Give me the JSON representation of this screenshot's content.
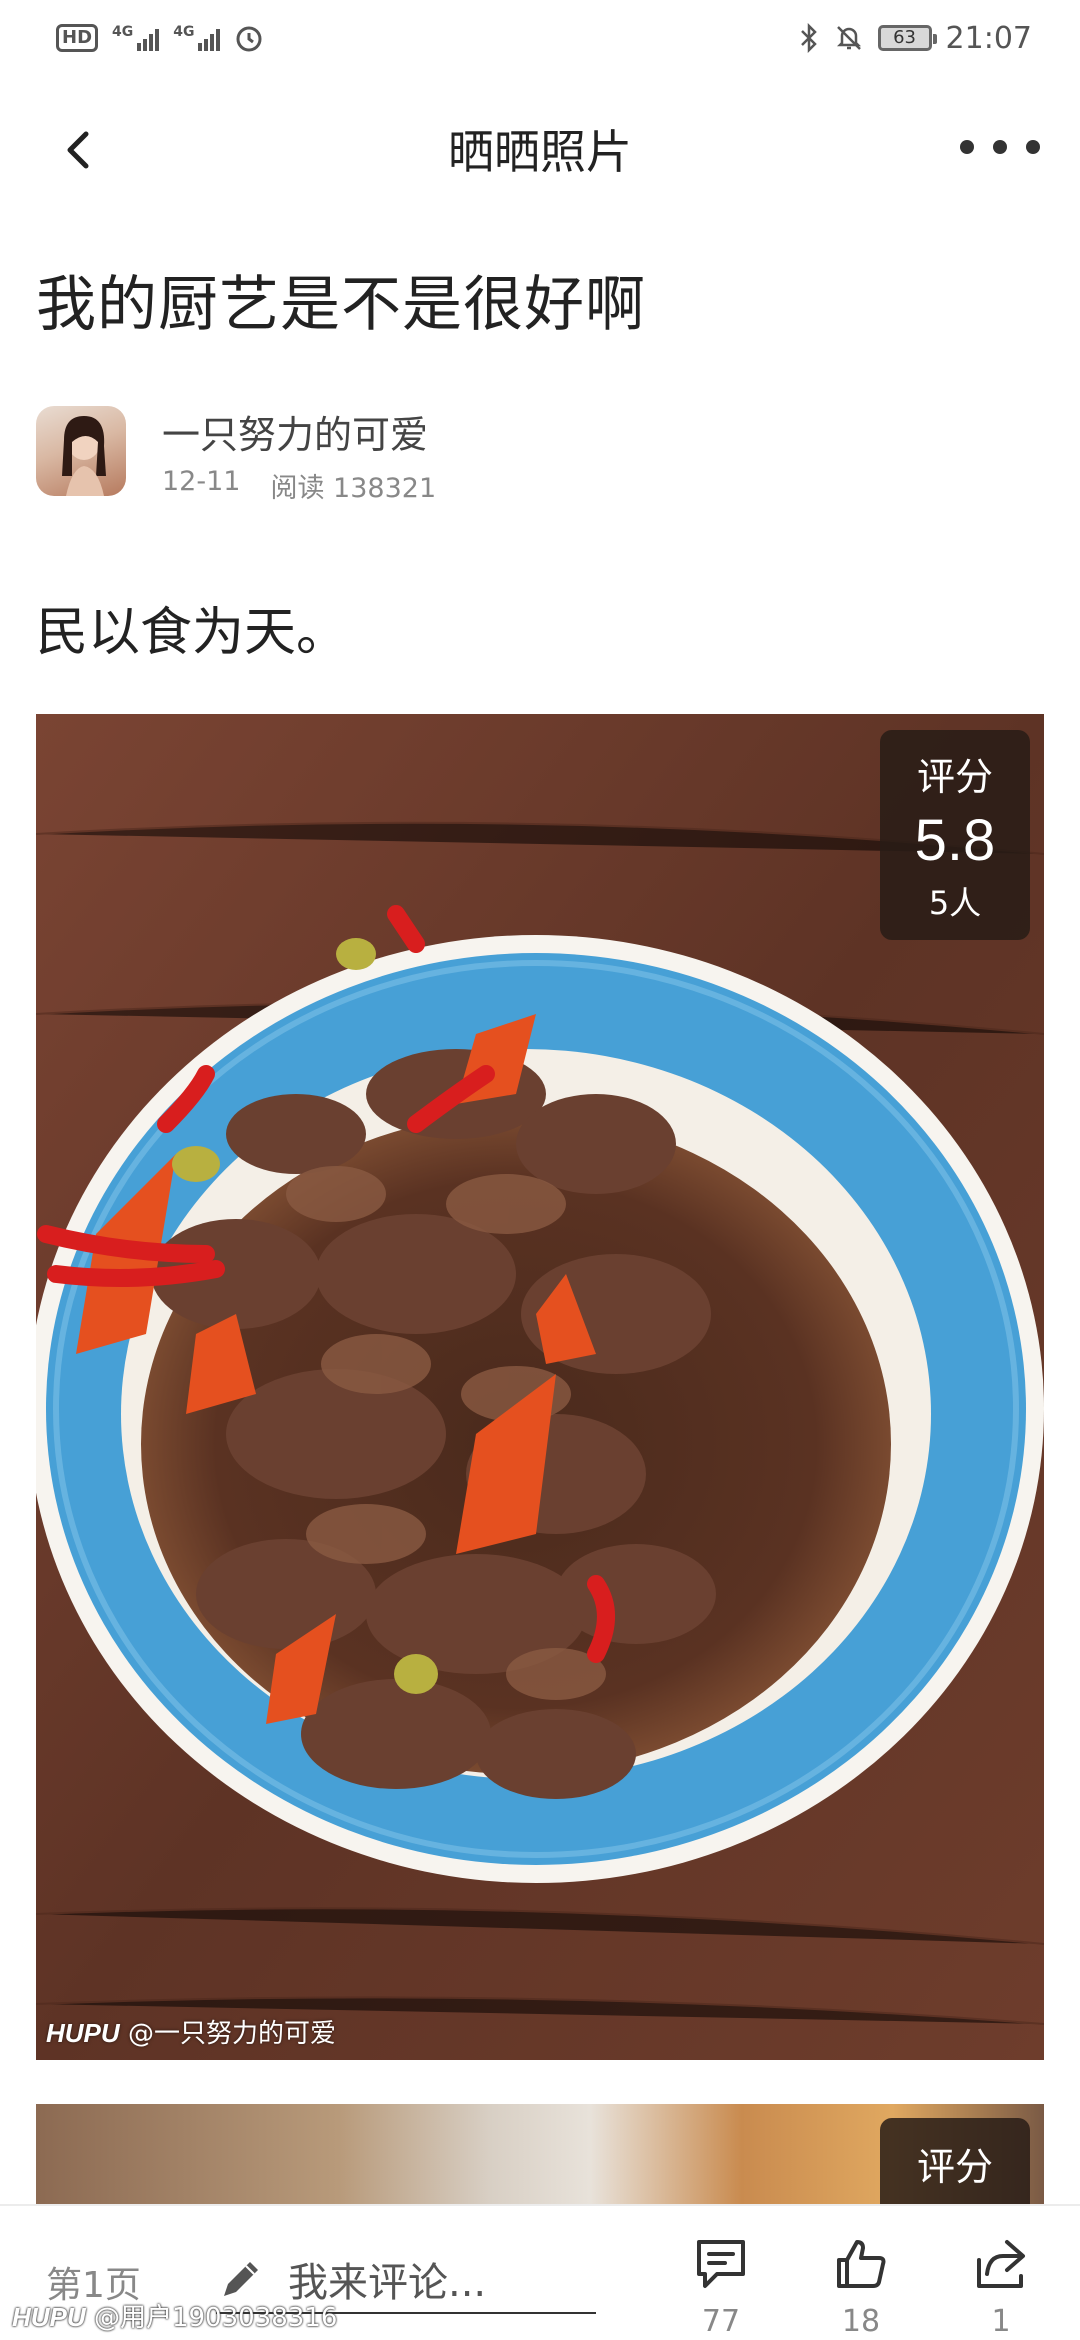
{
  "status_bar": {
    "left_badges": [
      "HD",
      "4G",
      "4G"
    ],
    "battery": "63",
    "time": "21:07",
    "icons": [
      "hd-icon",
      "signal-4g-icon",
      "signal-4g-icon",
      "alarm-icon",
      "bluetooth-icon",
      "mute-icon",
      "battery-icon"
    ]
  },
  "nav": {
    "title": "晒晒照片",
    "back_icon": "chevron-left-icon",
    "more_icon": "more-dots-icon"
  },
  "post": {
    "title": "我的厨艺是不是很好啊",
    "author": "一只努力的可爱",
    "date": "12-11",
    "reads": "阅读 138321",
    "body": "民以食为天。"
  },
  "photo": {
    "rating_label": "评分",
    "rating_score": "5.8",
    "rating_count": "5人",
    "watermark_brand": "HUPU",
    "watermark_user": "@一只努力的可爱"
  },
  "photo2": {
    "rating_label": "评分"
  },
  "bottom_bar": {
    "page": "第1页",
    "comment_placeholder": "我来评论...",
    "comment_count": "77",
    "like_count": "18",
    "share_count": "1",
    "watermark_brand": "HUPU",
    "watermark_user": "@用户1903038316"
  },
  "colors": {
    "plate_blue": "#4aa3d8",
    "table_brown": "#6b3b2a",
    "badge_bg": "#2a1c16"
  }
}
